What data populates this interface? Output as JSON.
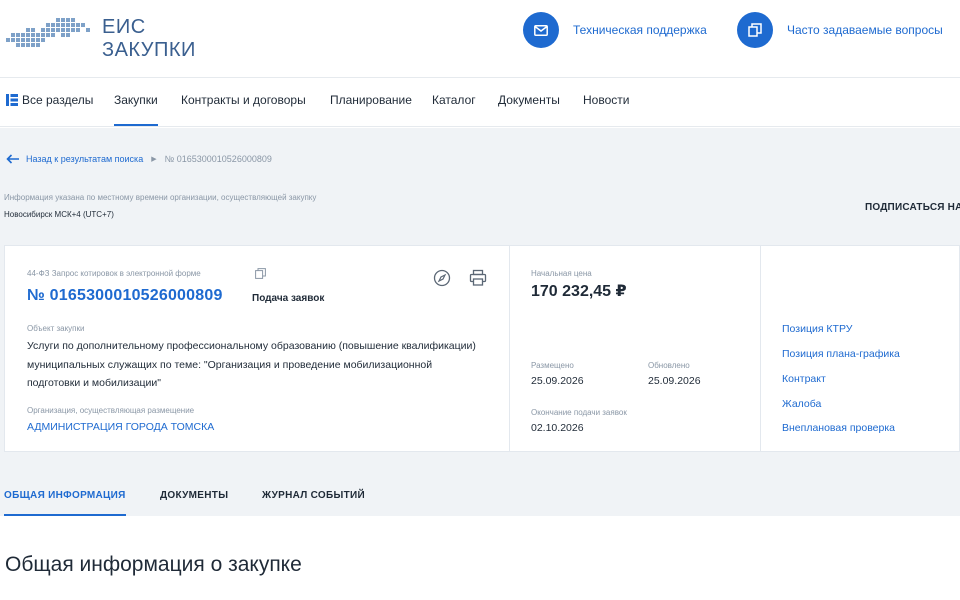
{
  "brand": {
    "line1": "ЕИС",
    "line2": "ЗАКУПКИ"
  },
  "header_links": [
    {
      "label": "Техническая поддержка",
      "icon": "mail-icon"
    },
    {
      "label": "Часто задаваемые вопросы",
      "icon": "faq-icon"
    }
  ],
  "nav": {
    "items": [
      {
        "label": "Все разделы"
      },
      {
        "label": "Закупки",
        "active": true
      },
      {
        "label": "Контракты и договоры"
      },
      {
        "label": "Планирование"
      },
      {
        "label": "Каталог"
      },
      {
        "label": "Документы"
      },
      {
        "label": "Новости"
      }
    ]
  },
  "breadcrumb": {
    "back": "Назад к результатам поиска",
    "current": "№ 0165300010526000809"
  },
  "timezone": {
    "note": "Информация указана по местному времени организации, осуществляющей закупку",
    "value": "Новосибирск МСК+4 (UTC+7)"
  },
  "subscribe": "ПОДПИСАТЬСЯ НА",
  "purchase": {
    "law_type": "44-ФЗ Запрос котировок в электронной форме",
    "number": "№ 0165300010526000809",
    "status": "Подача заявок",
    "object_label": "Объект закупки",
    "object_text": "Услуги по дополнительному профессиональному образованию (повышение квалификации) муниципальных служащих по теме: \"Организация и проведение мобилизационной подготовки и мобилизации\"",
    "org_label": "Организация, осуществляющая размещение",
    "org_name": "АДМИНИСТРАЦИЯ ГОРОДА ТОМСКА",
    "price_label": "Начальная цена",
    "price": "170 232,45 ₽",
    "placed_label": "Размещено",
    "placed_date": "25.09.2026",
    "updated_label": "Обновлено",
    "updated_date": "25.09.2026",
    "deadline_label": "Окончание подачи заявок",
    "deadline_date": "02.10.2026"
  },
  "side_links": [
    "Позиция КТРУ",
    "Позиция плана-графика",
    "Контракт",
    "Жалоба",
    "Внеплановая проверка"
  ],
  "tabs": [
    {
      "label": "ОБЩАЯ ИНФОРМАЦИЯ",
      "active": true
    },
    {
      "label": "ДОКУМЕНТЫ"
    },
    {
      "label": "ЖУРНАЛ СОБЫТИЙ"
    }
  ],
  "section_title": "Общая информация о закупке",
  "colors": {
    "accent": "#1e6ad0",
    "logo": "#3a5f8f",
    "background": "#f0f3f6"
  }
}
